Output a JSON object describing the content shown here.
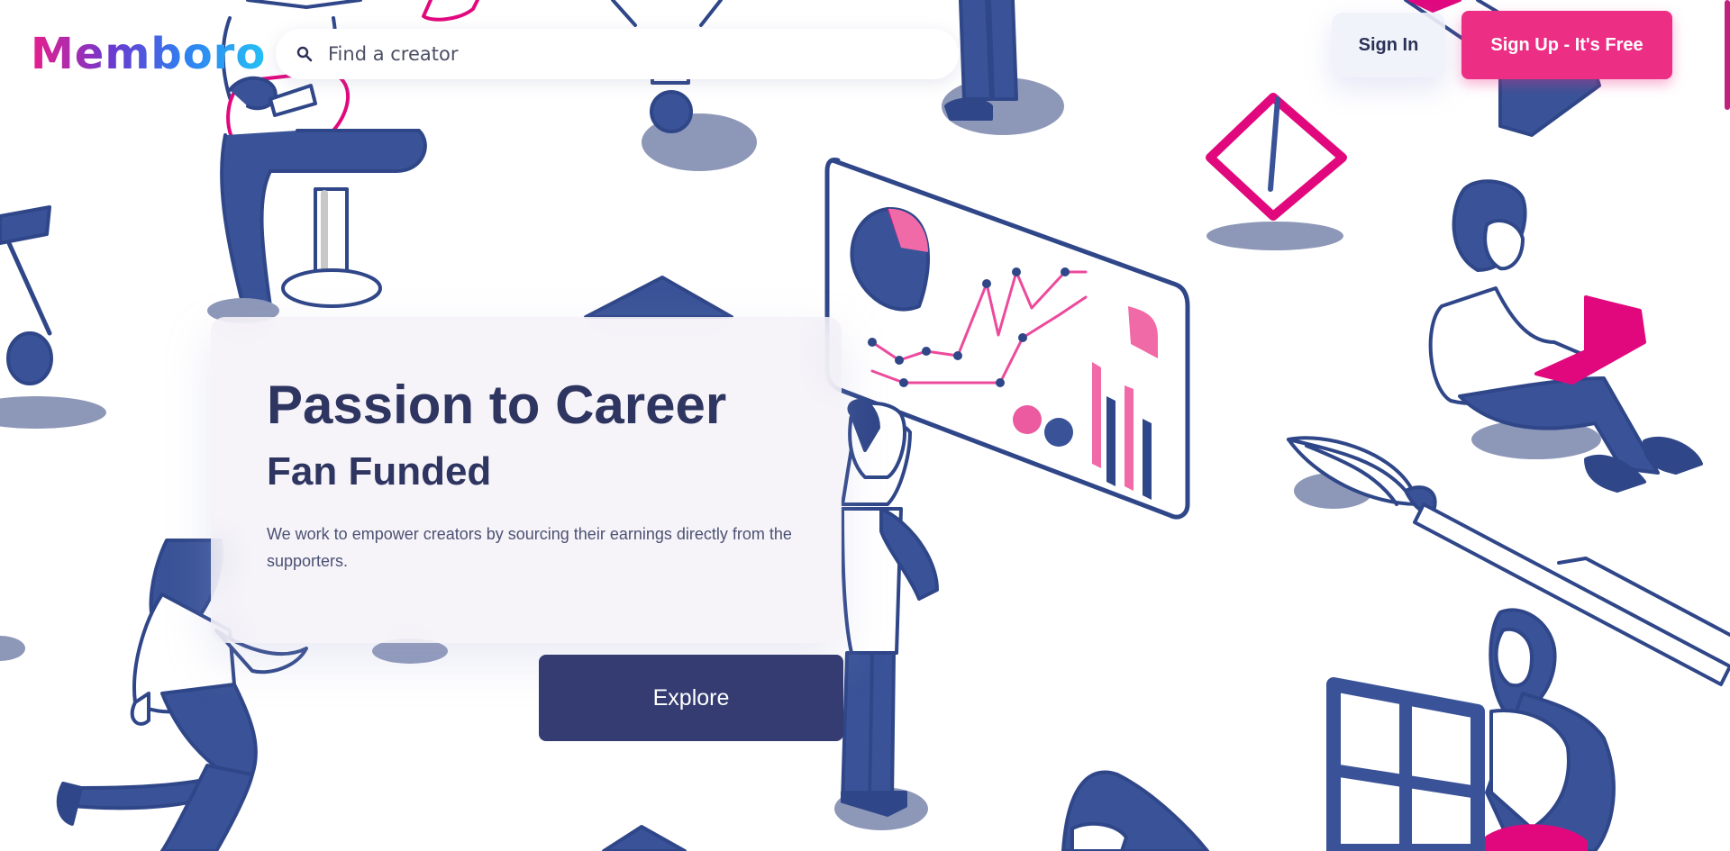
{
  "brand": {
    "logo_text": "Memboro"
  },
  "search": {
    "placeholder": "Find a creator",
    "value": ""
  },
  "auth": {
    "sign_in_label": "Sign In",
    "sign_up_label": "Sign Up - It's Free"
  },
  "hero": {
    "title": "Passion to Career",
    "subtitle": "Fan Funded",
    "description": "We work to empower creators by sourcing their earnings directly from the supporters.",
    "cta_label": "Explore"
  },
  "colors": {
    "primary_navy": "#343c72",
    "illustration_blue": "#3a5398",
    "accent_pink": "#ec2e84",
    "shadow_grey": "#8d97b8"
  },
  "icons": [
    "search-icon"
  ]
}
